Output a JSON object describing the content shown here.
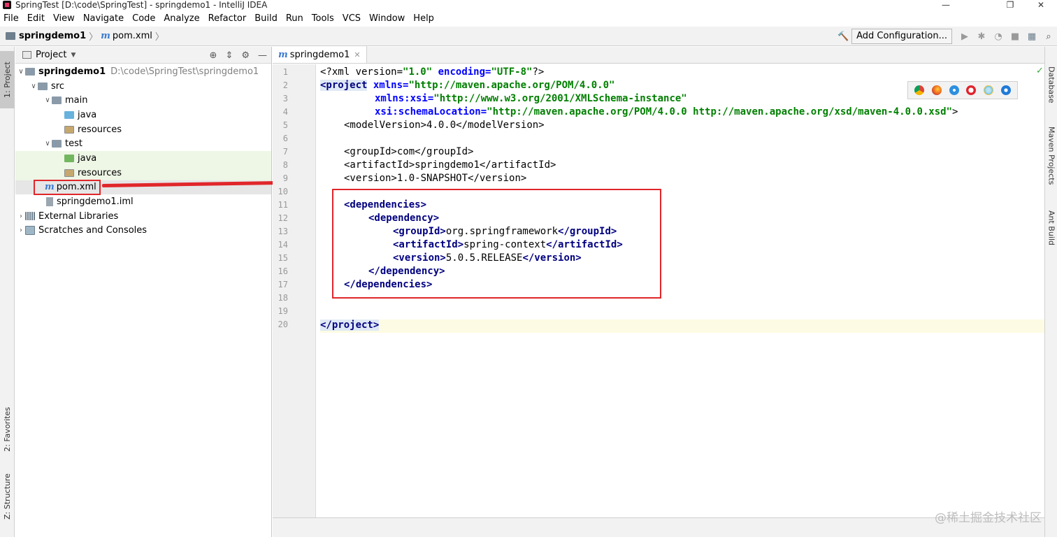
{
  "window": {
    "title": "SpringTest [D:\\code\\SpringTest] - springdemo1 - IntelliJ IDEA",
    "minimize": "—",
    "restore": "❐",
    "close": "✕"
  },
  "menu": [
    "File",
    "Edit",
    "View",
    "Navigate",
    "Code",
    "Analyze",
    "Refactor",
    "Build",
    "Run",
    "Tools",
    "VCS",
    "Window",
    "Help"
  ],
  "navbar": {
    "crumb_project": "springdemo1",
    "crumb_file": "pom.xml",
    "add_configuration": "Add Configuration..."
  },
  "left_tabs": {
    "project": "1: Project",
    "favorites": "2: Favorites",
    "structure": "Z: Structure"
  },
  "right_tabs": {
    "database": "Database",
    "maven": "Maven Projects",
    "ant": "Ant Build"
  },
  "project_panel": {
    "title": "Project",
    "tree": {
      "root": "springdemo1",
      "root_path": "D:\\code\\SpringTest\\springdemo1",
      "src": "src",
      "main": "main",
      "java": "java",
      "resources": "resources",
      "test": "test",
      "test_java": "java",
      "test_resources": "resources",
      "pom": "pom.xml",
      "iml": "springdemo1.iml",
      "external": "External Libraries",
      "scratches": "Scratches and Consoles"
    }
  },
  "editor": {
    "tab": "springdemo1",
    "lines": [
      "1",
      "2",
      "3",
      "4",
      "5",
      "6",
      "7",
      "8",
      "9",
      "10",
      "11",
      "12",
      "13",
      "14",
      "15",
      "16",
      "17",
      "18",
      "19",
      "20"
    ],
    "code": {
      "l1a": "<?xml version=",
      "l1b": "\"1.0\"",
      "l1c": " encoding=",
      "l1d": "\"UTF-8\"",
      "l1e": "?>",
      "l2a": "<project",
      "l2b": " xmlns=",
      "l2c": "\"http://maven.apache.org/POM/4.0.0\"",
      "l3a": "xmlns:xsi=",
      "l3b": "\"http://www.w3.org/2001/XMLSchema-instance\"",
      "l4a": "xsi:schemaLocation=",
      "l4b": "\"http://maven.apache.org/POM/4.0.0 http://maven.apache.org/xsd/maven-4.0.0.xsd\"",
      "l4c": ">",
      "l5a": "<modelVersion>",
      "l5b": "4.0.0",
      "l5c": "</modelVersion>",
      "l7a": "<groupId>",
      "l7b": "com",
      "l7c": "</groupId>",
      "l8a": "<artifactId>",
      "l8b": "springdemo1",
      "l8c": "</artifactId>",
      "l9a": "<version>",
      "l9b": "1.0-SNAPSHOT",
      "l9c": "</version>",
      "l11": "<dependencies>",
      "l12": "<dependency>",
      "l13a": "<groupId>",
      "l13b": "org.springframework",
      "l13c": "</groupId>",
      "l14a": "<artifactId>",
      "l14b": "spring-context",
      "l14c": "</artifactId>",
      "l15a": "<version>",
      "l15b": "5.0.5.RELEASE",
      "l15c": "</version>",
      "l16": "</dependency>",
      "l17": "</dependencies>",
      "l20": "</project>"
    }
  },
  "watermark": "@稀土掘金技术社区"
}
